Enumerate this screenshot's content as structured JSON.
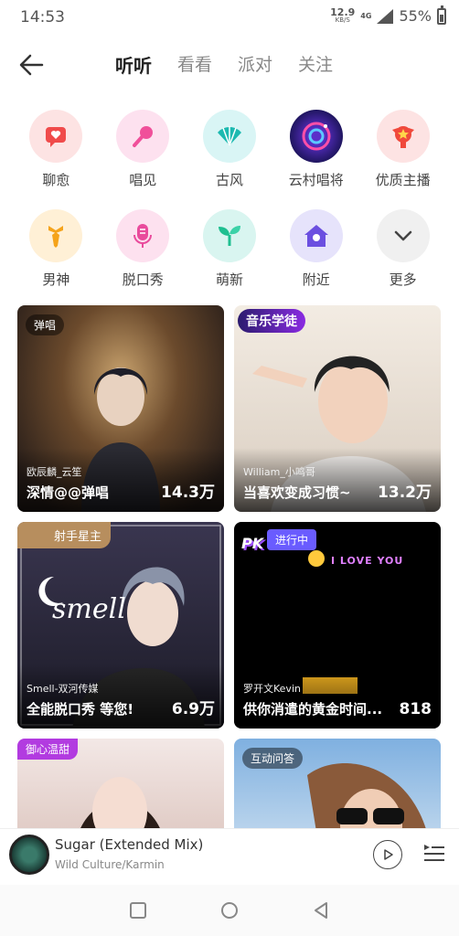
{
  "status_bar": {
    "time": "14:53",
    "speed_value": "12.9",
    "speed_unit": "KB/S",
    "network": "4G",
    "battery": "55%"
  },
  "header": {
    "tabs": [
      {
        "label": "听听",
        "active": true
      },
      {
        "label": "看看",
        "active": false
      },
      {
        "label": "派对",
        "active": false
      },
      {
        "label": "关注",
        "active": false
      }
    ]
  },
  "categories": [
    {
      "label": "聊愈",
      "icon": "heart-chat-icon",
      "bg": "#fde3e3",
      "color": "#f04b4b"
    },
    {
      "label": "唱见",
      "icon": "microphone-icon",
      "bg": "#fde1ef",
      "color": "#f0509a"
    },
    {
      "label": "古风",
      "icon": "fan-icon",
      "bg": "#d9f5f5",
      "color": "#1cb9b0"
    },
    {
      "label": "云村唱将",
      "icon": "cloud-village-icon",
      "bg": "#2a1d6e",
      "color": "#ff4fa8"
    },
    {
      "label": "优质主播",
      "icon": "star-badge-icon",
      "bg": "#fde3e3",
      "color": "#f0493c"
    },
    {
      "label": "男神",
      "icon": "tie-icon",
      "bg": "#fff0d6",
      "color": "#f5a31a"
    },
    {
      "label": "脱口秀",
      "icon": "mic-talk-icon",
      "bg": "#fde1ef",
      "color": "#e94b9c"
    },
    {
      "label": "萌新",
      "icon": "sprout-icon",
      "bg": "#d9f5f0",
      "color": "#1fbf90"
    },
    {
      "label": "附近",
      "icon": "location-home-icon",
      "bg": "#e6e3fb",
      "color": "#6b4fe0"
    },
    {
      "label": "更多",
      "icon": "chevron-down-icon",
      "bg": "#f0f0f0",
      "color": "#444"
    }
  ],
  "cards": [
    {
      "tag": "弹唱",
      "sub": "欧辰麟_云笙",
      "title": "深情@@弹唱",
      "count": "14.3万",
      "bg1": "#6b4a2c",
      "bg2": "#2a1f1a"
    },
    {
      "tag": "音乐学徒",
      "sub": "William_小鸣哥",
      "title": "当喜欢变成习惯~",
      "count": "13.2万",
      "bg1": "#efe7dc",
      "bg2": "#b8a89a"
    },
    {
      "tag": "射手星主",
      "sub": "Smell-双河传媒",
      "title": "全能脱口秀 等您!",
      "count": "6.9万",
      "bg1": "#3a3650",
      "bg2": "#1b1a26"
    },
    {
      "tag": "进行中",
      "sub": "罗开文Kevin",
      "title": "供你消遣的黄金时间...",
      "count": "818",
      "bg1": "#000000",
      "bg2": "#111111"
    },
    {
      "tag": "御心温甜",
      "sub": "",
      "title": "",
      "count": "",
      "bg1": "#f3e8e6",
      "bg2": "#caa99e"
    },
    {
      "tag": "互动问答",
      "sub": "",
      "title": "",
      "count": "",
      "bg1": "#7fb0e0",
      "bg2": "#e8c9a8"
    }
  ],
  "card_text": {
    "smell": "smell",
    "i_love_you": "I LOVE YOU",
    "pk": "PK"
  },
  "player": {
    "title": "Sugar (Extended Mix)",
    "artist": "Wild Culture/Karmin"
  }
}
